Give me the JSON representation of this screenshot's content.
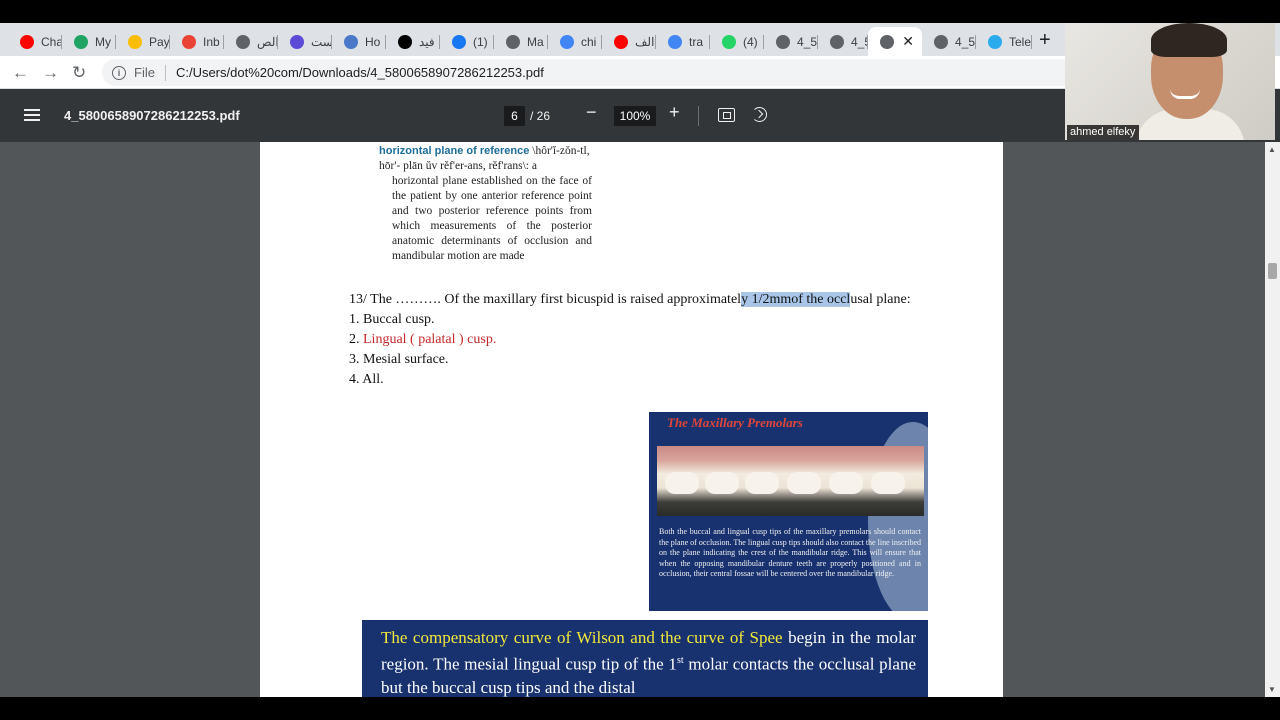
{
  "browser": {
    "tabs": [
      {
        "label": "Cha",
        "icon": "youtube-icon",
        "color": "#ff0000"
      },
      {
        "label": "My",
        "icon": "google-drive-icon",
        "color": "#1fa463"
      },
      {
        "label": "Pay",
        "icon": "google-pay-icon",
        "color": "#fbbc04"
      },
      {
        "label": "Inb",
        "icon": "gmail-icon",
        "color": "#ea4335"
      },
      {
        "label": "الص",
        "icon": "globe-icon",
        "color": "#5f6368"
      },
      {
        "label": "است",
        "icon": "star-chat-icon",
        "color": "#5b4bd6"
      },
      {
        "label": "Ho",
        "icon": "calendar-icon",
        "color": "#4a78c8"
      },
      {
        "label": "فيد",
        "icon": "y-logo-icon",
        "color": "#000000"
      },
      {
        "label": "(1)",
        "icon": "facebook-icon",
        "color": "#1877f2"
      },
      {
        "label": "Ma",
        "icon": "globe-icon",
        "color": "#5f6368"
      },
      {
        "label": "chi",
        "icon": "google-icon",
        "color": "#4285f4"
      },
      {
        "label": "الف",
        "icon": "youtube-icon",
        "color": "#ff0000"
      },
      {
        "label": "tra",
        "icon": "google-icon",
        "color": "#4285f4"
      },
      {
        "label": "(4)",
        "icon": "whatsapp-icon",
        "color": "#25d366"
      },
      {
        "label": "4_5",
        "icon": "globe-icon",
        "color": "#5f6368"
      },
      {
        "label": "4_5",
        "icon": "globe-icon",
        "color": "#5f6368"
      },
      {
        "label": "",
        "icon": "globe-icon",
        "color": "#5f6368",
        "active": true
      },
      {
        "label": "4_5",
        "icon": "globe-icon",
        "color": "#5f6368"
      },
      {
        "label": "Tele",
        "icon": "telegram-icon",
        "color": "#2aabee"
      }
    ],
    "address": {
      "scheme_label": "File",
      "url": "C:/Users/dot%20com/Downloads/4_5800658907286212253.pdf"
    }
  },
  "pdf_viewer": {
    "title": "4_5800658907286212253.pdf",
    "current_page": "6",
    "page_total": "/ 26",
    "zoom": "100%"
  },
  "webcam": {
    "name": "ahmed elfeky"
  },
  "document": {
    "dictionary": {
      "term": "horizontal plane of reference",
      "pronunciation": "\\hôr'ĭ-zŏn-tl, hōr'- plān ŭv rĕf'er-ans, rĕf'rans\\: a",
      "definition": "horizontal plane established on the face of the patient by one anterior reference point and two posterior reference points from which measurements of the posterior anatomic determinants of occlusion and mandibular motion are made"
    },
    "question": {
      "stem_before": "13/ The ………. Of the maxillary first bicuspid is raised approximatel",
      "stem_highlight": "y 1/2mmof the occl",
      "stem_after": "usal plane:",
      "options": [
        {
          "num": "1.",
          "text": "Buccal cusp."
        },
        {
          "num": "2.",
          "text": "Lingual ( palatal ) cusp.",
          "correct": true
        },
        {
          "num": "3.",
          "text": "Mesial surface."
        },
        {
          "num": "4.",
          "text": "All."
        }
      ]
    },
    "slide_premolars": {
      "title": "The Maxillary Premolars",
      "body": "Both the buccal and lingual cusp tips of the maxillary premolars should contact the plane of occlusion. The lingual cusp tips should also contact the line inscribed on the plane indicating the crest of the mandibular ridge. This will ensure that when the opposing mandibular denture teeth are properly positioned and in occlusion, their central fossae will be centered over the mandibular ridge."
    },
    "slide_curves": {
      "highlight": "The compensatory curve of Wilson and the curve of Spee",
      "text1": " begin in the molar region. The mesial lingual cusp tip of the 1",
      "sup": "st",
      "text2": " molar contacts the occlusal plane but the buccal cusp tips and the distal"
    }
  }
}
